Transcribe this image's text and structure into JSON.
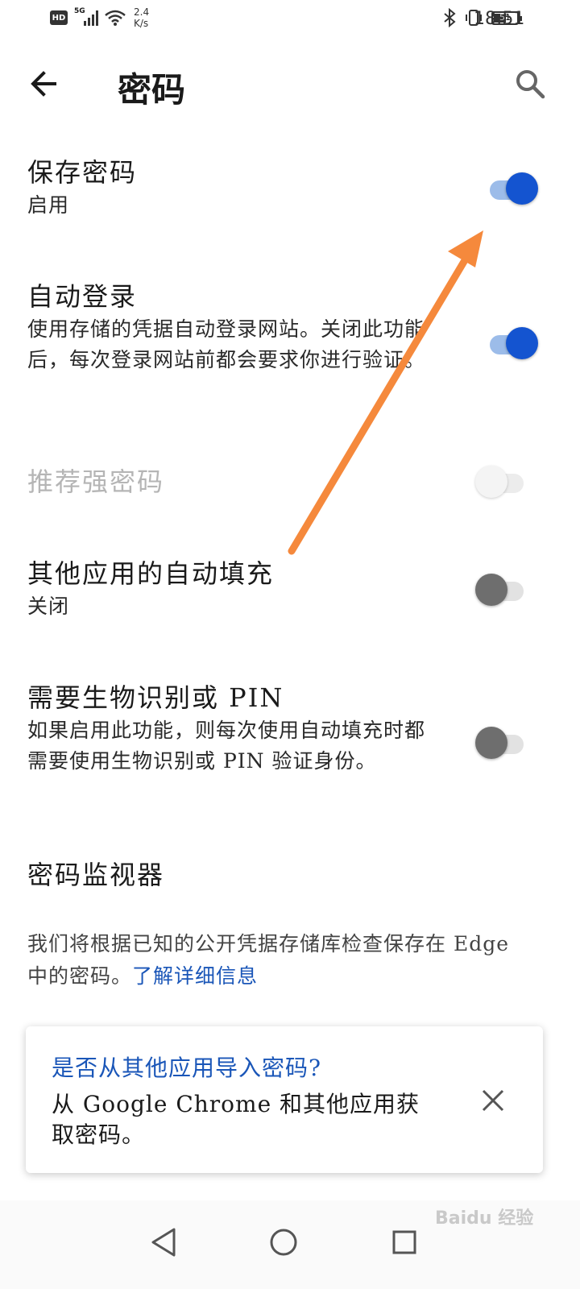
{
  "status_bar": {
    "hd": "HD",
    "network": "5G",
    "speed_top": "2.4",
    "speed_bottom": "K/s",
    "battery": "51",
    "time": "18:51"
  },
  "header": {
    "title": "密码",
    "back_icon": "arrow-back-icon",
    "search_icon": "search-icon"
  },
  "settings": [
    {
      "title": "保存密码",
      "subtitle": "启用",
      "toggle": "on"
    },
    {
      "title": "自动登录",
      "subtitle": "使用存储的凭据自动登录网站。关闭此功能后，每次登录网站前都会要求你进行验证。",
      "toggle": "on"
    },
    {
      "title": "推荐强密码",
      "subtitle": "",
      "toggle": "disabled"
    },
    {
      "title": "其他应用的自动填充",
      "subtitle": "关闭",
      "toggle": "off"
    },
    {
      "title": "需要生物识别或 PIN",
      "subtitle": "如果启用此功能，则每次使用自动填充时都需要使用生物识别或 PIN 验证身份。",
      "toggle": "off"
    }
  ],
  "monitor": {
    "title": "密码监视器",
    "description": "我们将根据已知的公开凭据存储库检查保存在 Edge 中的密码。",
    "link": "了解详细信息"
  },
  "import_card": {
    "title": "是否从其他应用导入密码?",
    "body": "从 Google Chrome 和其他应用获取密码。",
    "close_icon": "close-icon"
  },
  "nav": {
    "back_icon": "triangle-back-icon",
    "home_icon": "circle-home-icon",
    "recents_icon": "square-recents-icon"
  },
  "watermark": "Baidu 经验",
  "colors": {
    "accent": "#1454d0",
    "link": "#1a56b8",
    "annotation_arrow": "#f5893c"
  }
}
